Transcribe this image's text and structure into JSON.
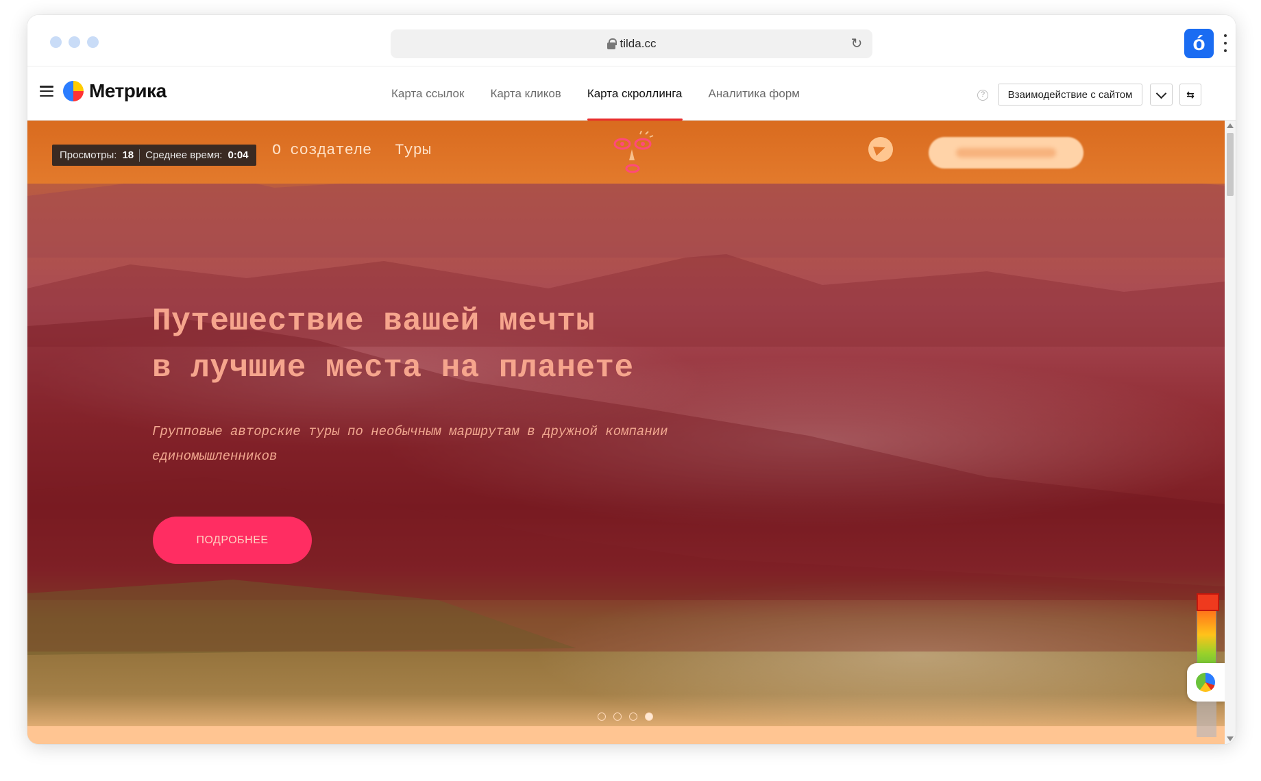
{
  "browser": {
    "url": "tilda.cc",
    "profile_button_label": "ó",
    "icons": [
      "lock-icon",
      "reload-icon",
      "more-icon"
    ]
  },
  "metrika": {
    "logo_text": "Метрика",
    "tabs": [
      {
        "label": "Карта ссылок",
        "active": false
      },
      {
        "label": "Карта кликов",
        "active": false
      },
      {
        "label": "Карта скроллинга",
        "active": true
      },
      {
        "label": "Аналитика форм",
        "active": false
      }
    ],
    "help_label": "?",
    "mode_select": "Взаимодействие с сайтом",
    "accent_color": "#e82c2c"
  },
  "stats": {
    "views_label": "Просмотры:",
    "views_value": "18",
    "avg_time_label": "Среднее время:",
    "avg_time_value": "0:04"
  },
  "site": {
    "nav": [
      "О создателе",
      "Туры"
    ],
    "headline_line1": "Путешествие вашей мечты",
    "headline_line2": "в лучшие места на планете",
    "subtitle": "Групповые авторские туры по необычным маршрутам в дружной компании единомышленников",
    "more_button": "ПОДРОБНЕЕ",
    "slides_total": 4,
    "active_slide": 4,
    "accent_color": "#ff2d62"
  },
  "heatmap_legend": {
    "colors": [
      "#e52d1a",
      "#ff7a1a",
      "#ffc21a",
      "#9ad12a",
      "#6ac23a"
    ]
  }
}
